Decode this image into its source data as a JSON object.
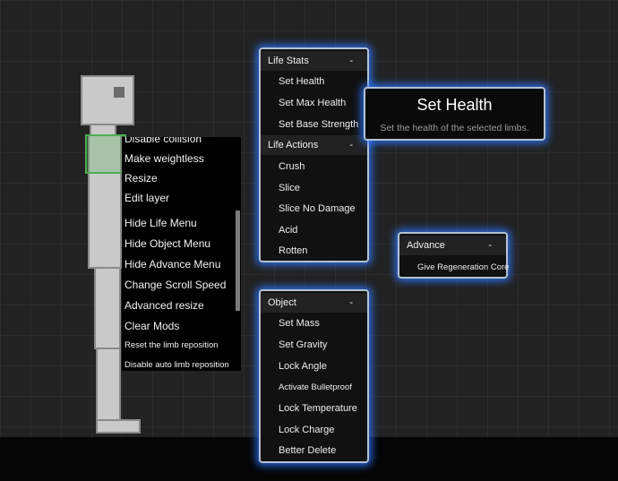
{
  "context_menu": {
    "items": [
      {
        "label": "Disable collision",
        "size": "normal"
      },
      {
        "label": "Make weightless",
        "size": "normal"
      },
      {
        "label": "Resize",
        "size": "normal"
      },
      {
        "label": "Edit layer",
        "size": "normal"
      },
      {
        "label": "Hide Life Menu",
        "size": "normal"
      },
      {
        "label": "Hide Object Menu",
        "size": "normal"
      },
      {
        "label": "Hide Advance Menu",
        "size": "normal"
      },
      {
        "label": "Change Scroll Speed",
        "size": "normal"
      },
      {
        "label": "Advanced resize",
        "size": "normal"
      },
      {
        "label": "Clear Mods",
        "size": "normal"
      },
      {
        "label": "Reset the limb reposition",
        "size": "small"
      },
      {
        "label": "Disable auto limb reposition",
        "size": "small"
      }
    ]
  },
  "life_panel": {
    "sections": [
      {
        "title": "Life Stats",
        "toggle": "-",
        "items": [
          "Set Health",
          "Set Max Health",
          "Set Base Strength"
        ]
      },
      {
        "title": "Life Actions",
        "toggle": "-",
        "items": [
          "Crush",
          "Slice",
          "Slice No Damage",
          "Acid",
          "Rotten"
        ]
      }
    ]
  },
  "tooltip": {
    "title": "Set Health",
    "description": "Set the health of the selected limbs."
  },
  "advance_panel": {
    "title": "Advance",
    "toggle": "-",
    "items": [
      "Give Regeneration Core"
    ]
  },
  "object_panel": {
    "title": "Object",
    "toggle": "-",
    "items": [
      "Set Mass",
      "Set Gravity",
      "Lock Angle",
      "Activate Bulletproof",
      "Lock Temperature",
      "Lock Charge",
      "Better Delete"
    ]
  },
  "colors": {
    "background": "#222222",
    "panel_glow": "#2d78ff",
    "selection": "#4caf50",
    "ground": "#050505"
  }
}
